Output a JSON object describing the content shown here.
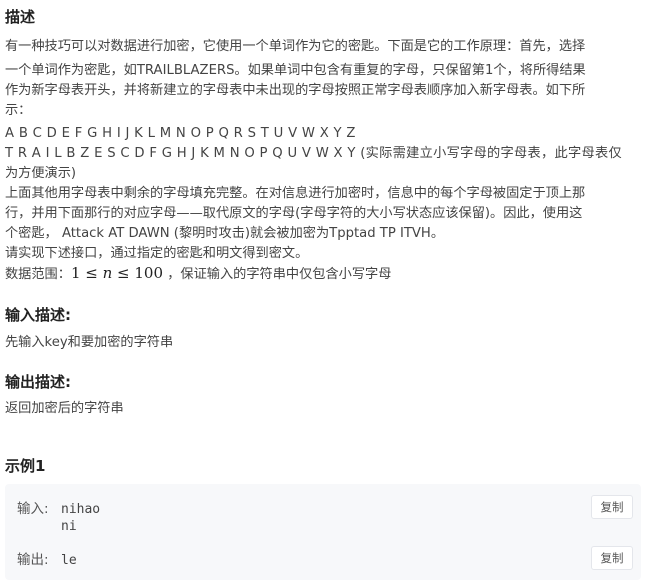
{
  "description": {
    "title": "描述",
    "lines": [
      "有一种技巧可以对数据进行加密，它使用一个单词作为它的密匙。下面是它的工作原理：首先，选择",
      "一个单词作为密匙，如TRAILBLAZERS。如果单词中包含有重复的字母，只保留第1个，将所得结果",
      "作为新字母表开头，并将新建立的字母表中未出现的字母按照正常字母表顺序加入新字母表。如下所",
      "示：",
      "A B C D E F G H I J K L M N O P Q R S T U V W X Y Z",
      "T R A I L B Z E S C D F G H J K M N O P Q U V W X Y (实际需建立小写字母的字母表，此字母表仅",
      "为方便演示)",
      "上面其他用字母表中剩余的字母填充完整。在对信息进行加密时，信息中的每个字母被固定于顶上那",
      "行，并用下面那行的对应字母——取代原文的字母(字母字符的大小写状态应该保留)。因此，使用这",
      "个密匙， Attack AT DAWN (黎明时攻击)就会被加密为Tpptad TP ITVH。",
      "请实现下述接口，通过指定的密匙和明文得到密文。"
    ],
    "range_prefix": "数据范围：",
    "range_lower": "1",
    "range_var": "n",
    "range_upper": "100",
    "range_suffix": "，保证输入的字符串中仅包含小写字母"
  },
  "input_desc": {
    "title": "输入描述:",
    "text": "先输入key和要加密的字符串"
  },
  "output_desc": {
    "title": "输出描述:",
    "text": "返回加密后的字符串"
  },
  "example": {
    "title": "示例1",
    "input_label": "输入:",
    "input_lines": [
      "nihao",
      "ni"
    ],
    "output_label": "输出:",
    "output_value": "le",
    "copy_label": "复制"
  }
}
